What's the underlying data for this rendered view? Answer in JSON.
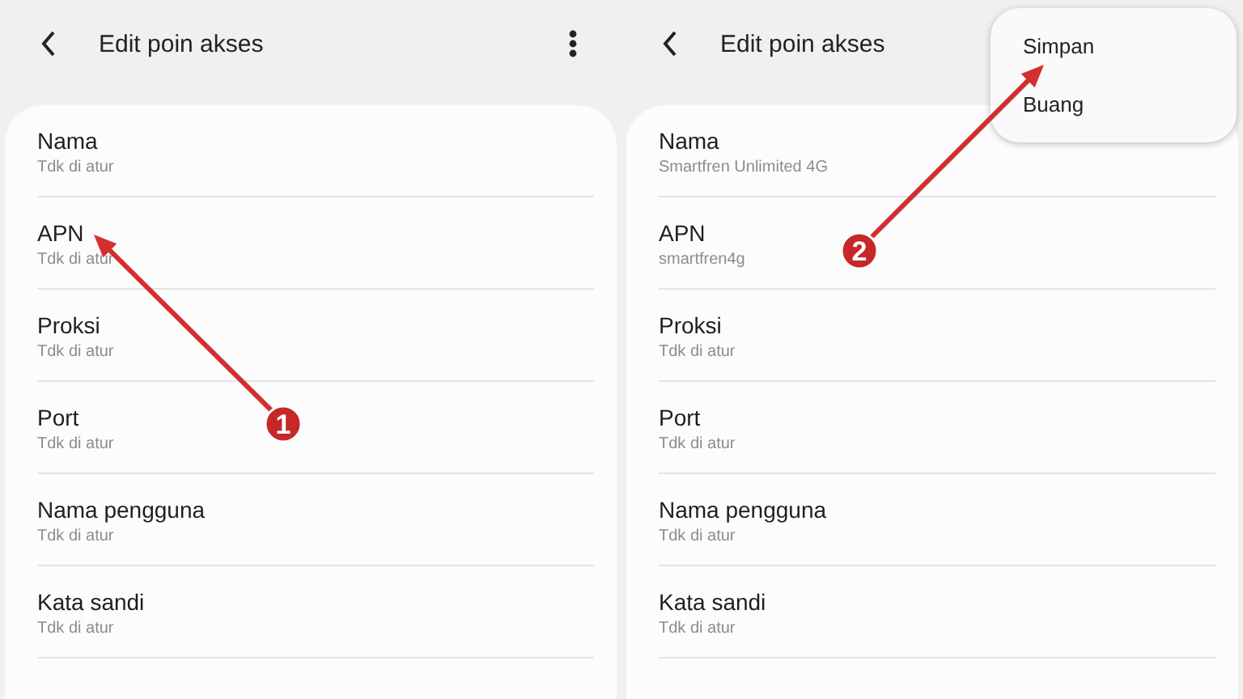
{
  "panels": [
    {
      "title": "Edit poin akses",
      "menu_open": false,
      "rows": [
        {
          "label": "Nama",
          "value": "Tdk di atur"
        },
        {
          "label": "APN",
          "value": "Tdk di atur"
        },
        {
          "label": "Proksi",
          "value": "Tdk di atur"
        },
        {
          "label": "Port",
          "value": "Tdk di atur"
        },
        {
          "label": "Nama pengguna",
          "value": "Tdk di atur"
        },
        {
          "label": "Kata sandi",
          "value": "Tdk di atur"
        }
      ]
    },
    {
      "title": "Edit poin akses",
      "menu_open": true,
      "menu": [
        "Simpan",
        "Buang"
      ],
      "rows": [
        {
          "label": "Nama",
          "value": "Smartfren Unlimited 4G"
        },
        {
          "label": "APN",
          "value": "smartfren4g"
        },
        {
          "label": "Proksi",
          "value": "Tdk di atur"
        },
        {
          "label": "Port",
          "value": "Tdk di atur"
        },
        {
          "label": "Nama pengguna",
          "value": "Tdk di atur"
        },
        {
          "label": "Kata sandi",
          "value": "Tdk di atur"
        }
      ]
    }
  ],
  "annotations": [
    {
      "label": "1"
    },
    {
      "label": "2"
    }
  ]
}
